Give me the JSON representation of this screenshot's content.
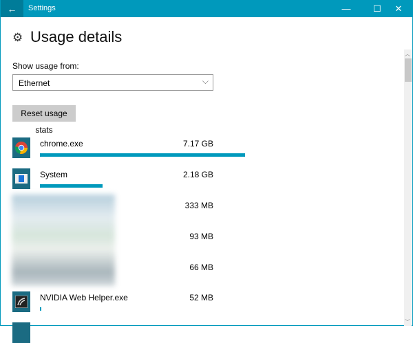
{
  "window": {
    "title": "Settings",
    "back": "←",
    "minimize": "—",
    "maximize": "☐",
    "close": "✕"
  },
  "page": {
    "title": "Usage details",
    "gear_icon": "⚙"
  },
  "filter": {
    "label": "Show usage from:",
    "value": "Ethernet",
    "chevron": "⌵"
  },
  "reset_label": "Reset usage stats",
  "apps": [
    {
      "name": "chrome.exe",
      "size": "7.17 GB",
      "fraction": 1.0
    },
    {
      "name": "System",
      "size": "2.18 GB",
      "fraction": 0.304
    },
    {
      "name": "",
      "size": "333 MB",
      "fraction": 0
    },
    {
      "name": "",
      "size": "93 MB",
      "fraction": 0
    },
    {
      "name": "",
      "size": "66 MB",
      "fraction": 0
    },
    {
      "name": "NVIDIA Web Helper.exe",
      "size": "52 MB",
      "fraction": 0.008
    }
  ],
  "colors": {
    "accent": "#0099bc"
  }
}
